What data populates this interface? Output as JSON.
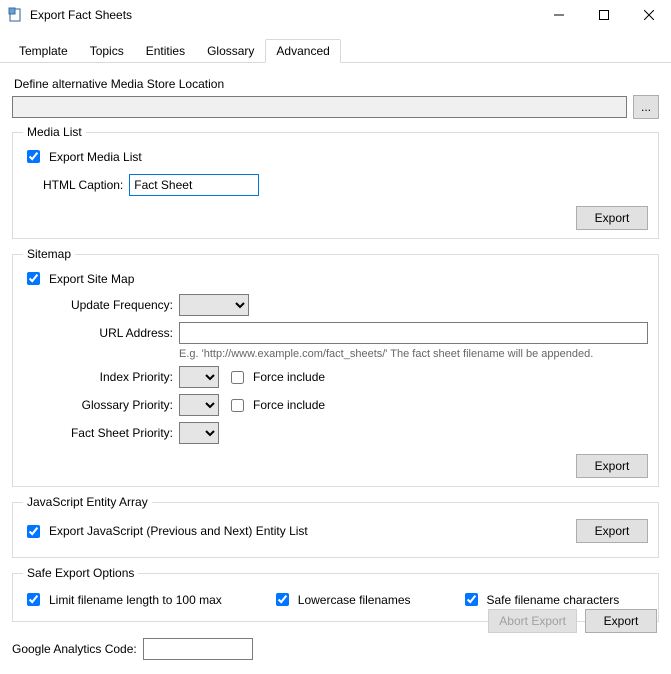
{
  "window": {
    "title": "Export Fact Sheets"
  },
  "tabs": [
    "Template",
    "Topics",
    "Entities",
    "Glossary",
    "Advanced"
  ],
  "mediaStore": {
    "label": "Define alternative Media Store Location",
    "value": "",
    "browse": "..."
  },
  "mediaList": {
    "legend": "Media List",
    "exportCb": "Export Media List",
    "captionLabel": "HTML Caption:",
    "captionValue": "Fact Sheet",
    "exportBtn": "Export"
  },
  "sitemap": {
    "legend": "Sitemap",
    "exportCb": "Export Site Map",
    "updateFreqLabel": "Update Frequency:",
    "urlLabel": "URL Address:",
    "urlValue": "",
    "urlHint": "E.g. 'http://www.example.com/fact_sheets/' The fact sheet filename will be appended.",
    "indexPriorityLabel": "Index Priority:",
    "glossaryPriorityLabel": "Glossary Priority:",
    "factSheetPriorityLabel": "Fact Sheet Priority:",
    "forceInclude": "Force include",
    "exportBtn": "Export"
  },
  "jsArray": {
    "legend": "JavaScript Entity Array",
    "exportCb": "Export JavaScript (Previous and Next) Entity List",
    "exportBtn": "Export"
  },
  "safe": {
    "legend": "Safe Export Options",
    "limit": "Limit filename length to 100 max",
    "lower": "Lowercase filenames",
    "safeChars": "Safe filename characters"
  },
  "analytics": {
    "label": "Google Analytics Code:",
    "value": ""
  },
  "footer": {
    "abort": "Abort Export",
    "export": "Export"
  }
}
